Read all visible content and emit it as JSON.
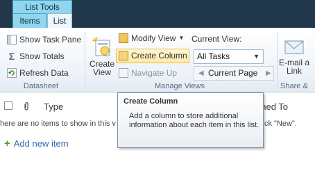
{
  "ribbon": {
    "context_group": "List Tools",
    "tabs": [
      {
        "label": "Items",
        "selected": false
      },
      {
        "label": "List",
        "selected": true
      }
    ],
    "groups": {
      "datasheet": {
        "label": "Datasheet",
        "buttons": [
          {
            "label": "Show Task Pane",
            "icon": "task-pane-icon"
          },
          {
            "label": "Show Totals",
            "icon": "totals-icon"
          },
          {
            "label": "Refresh Data",
            "icon": "refresh-icon"
          }
        ]
      },
      "manage_views": {
        "label": "Manage Views",
        "create_view": {
          "line1": "Create",
          "line2": "View"
        },
        "modify_view": "Modify View",
        "create_column": "Create Column",
        "navigate_up": "Navigate Up",
        "current_view_label": "Current View:",
        "current_view_value": "All Tasks",
        "current_page": "Current Page"
      },
      "share": {
        "email_link": {
          "line1": "E-mail a",
          "line2": "Link"
        },
        "label": "Share &"
      }
    }
  },
  "list": {
    "columns": [
      "Type",
      "gned To"
    ],
    "empty_message": "here are no items to show in this v",
    "empty_message_tail": "ck \"New\".",
    "add_new": "Add new item"
  },
  "tooltip": {
    "title": "Create Column",
    "body": "Add a column to store additional information about each item in this list."
  },
  "colors": {
    "ribbon_header": "#21374c",
    "context_tab": "#8fd6ee",
    "highlight": "#ffe9a8",
    "link": "#2a6ab0"
  }
}
